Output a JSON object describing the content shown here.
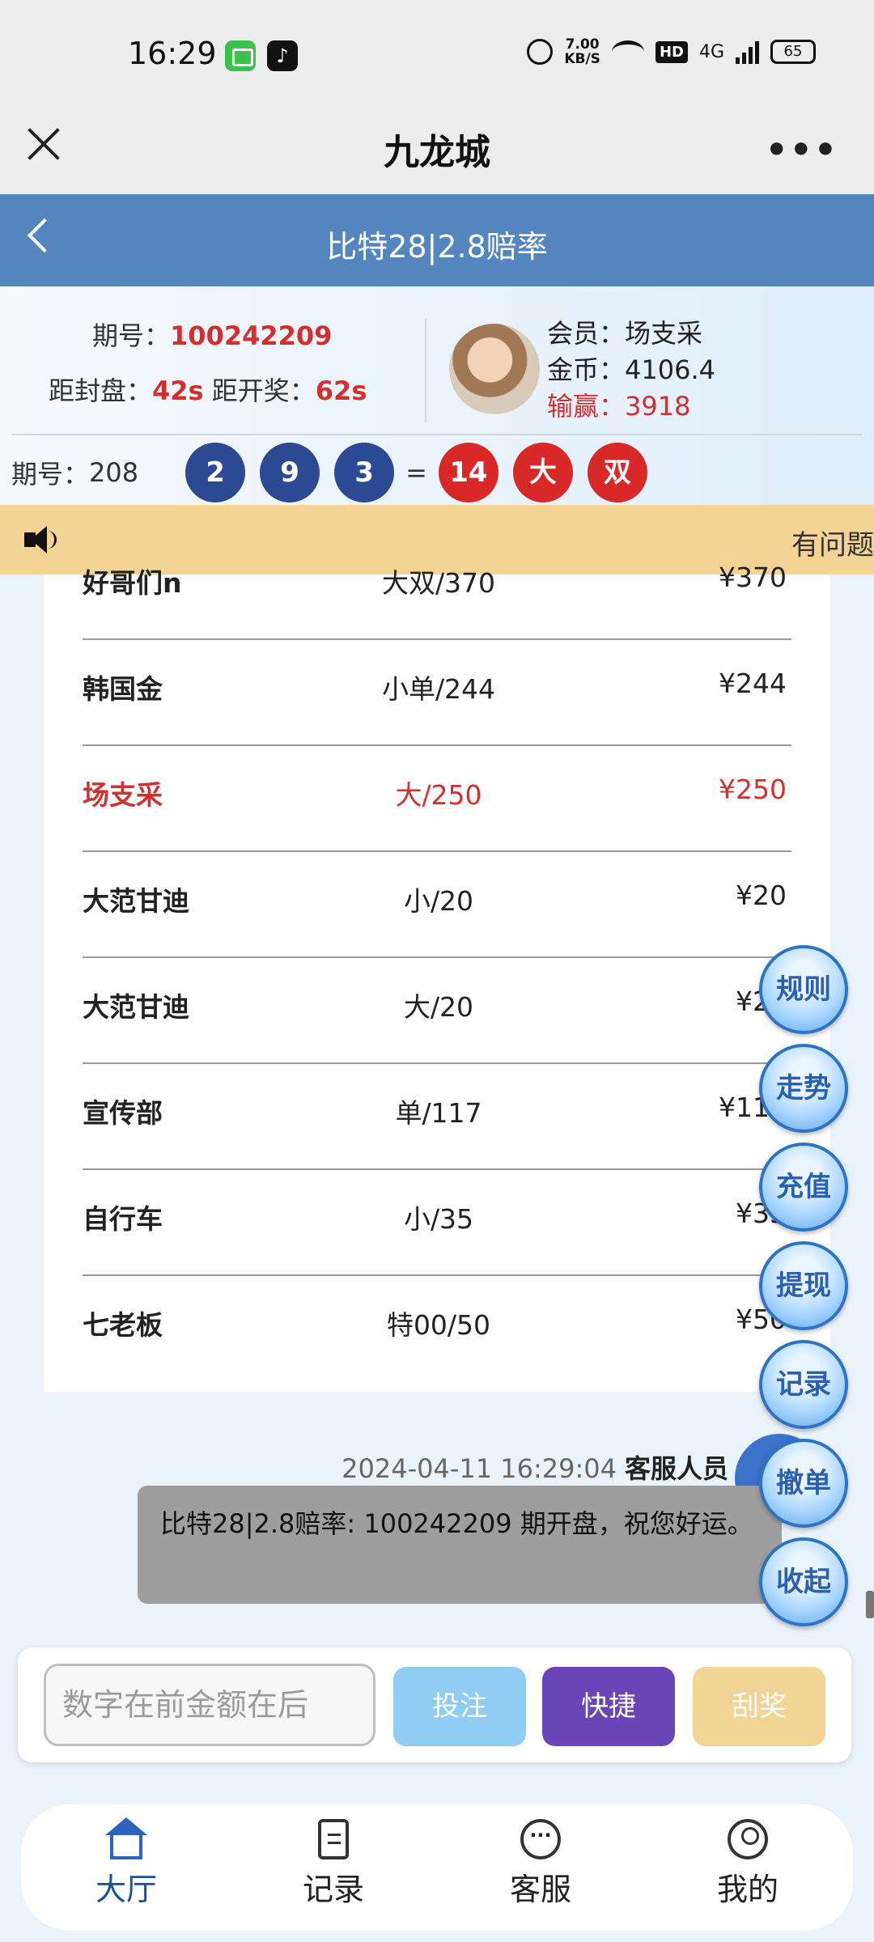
{
  "status": {
    "time": "16:29",
    "net_speed": "7.00",
    "net_unit": "KB/S",
    "hd": "HD",
    "network": "4G",
    "battery": "65"
  },
  "titlebar": {
    "title": "九龙城",
    "more": "•••"
  },
  "game": {
    "title": "比特28|2.8赔率"
  },
  "info": {
    "period_label": "期号：",
    "period": "100242209",
    "close_label": "距封盘：",
    "close_time": "42s",
    "draw_label": " 距开奖：",
    "draw_time": "62s",
    "member_label": "会员：",
    "member": "场支采",
    "coins_label": "金币：",
    "coins": "4106.4",
    "winloss_label": "输赢：",
    "winloss": "3918"
  },
  "last_result": {
    "period_label": "期号：",
    "period": "208",
    "balls": [
      "2",
      "9",
      "3"
    ],
    "equals": "=",
    "sum": "14",
    "size": "大",
    "parity": "双"
  },
  "notice": {
    "text": "有问题"
  },
  "bets": [
    {
      "name": "好哥们n",
      "bet": "大双/370",
      "amount": "¥370"
    },
    {
      "name": "韩国金",
      "bet": "小单/244",
      "amount": "¥244"
    },
    {
      "name": "场支采",
      "bet": "大/250",
      "amount": "¥250"
    },
    {
      "name": "大范甘迪",
      "bet": "小/20",
      "amount": "¥20"
    },
    {
      "name": "大范甘迪",
      "bet": "大/20",
      "amount": "¥20"
    },
    {
      "name": "宣传部",
      "bet": "单/117",
      "amount": "¥117"
    },
    {
      "name": "自行车",
      "bet": "小/35",
      "amount": "¥35"
    },
    {
      "name": "七老板",
      "bet": "特00/50",
      "amount": "¥50"
    }
  ],
  "chat": {
    "timestamp": "2024-04-11 16:29:04",
    "sender": "客服人员",
    "message": "比特28|2.8赔率: 100242209 期开盘，祝您好运。"
  },
  "fabs": [
    "规则",
    "走势",
    "充值",
    "提现",
    "记录",
    "撤单",
    "收起"
  ],
  "input": {
    "placeholder": "数字在前金额在后",
    "place_bet": "投注",
    "quick": "快捷",
    "scratch": "刮奖"
  },
  "nav": [
    {
      "label": "大厅",
      "icon": "home-icon"
    },
    {
      "label": "记录",
      "icon": "document-icon"
    },
    {
      "label": "客服",
      "icon": "chat-icon"
    },
    {
      "label": "我的",
      "icon": "user-icon"
    }
  ]
}
